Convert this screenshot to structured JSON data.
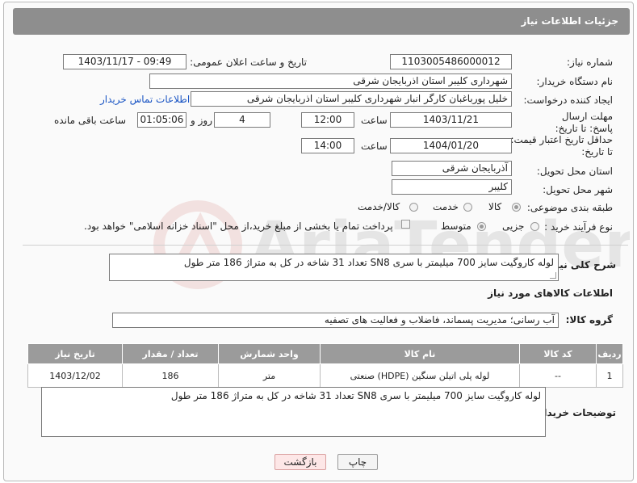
{
  "panel": {
    "title": "جزئیات اطلاعات نیاز"
  },
  "fields": {
    "need_number_label": "شماره نیاز:",
    "need_number": "1103005486000012",
    "announce_label": "تاریخ و ساعت اعلان عمومی:",
    "announce_value": "1403/11/17 - 09:49",
    "buyer_label": "نام دستگاه خریدار:",
    "buyer_value": "شهرداری کلیبر استان اذربایجان شرقی",
    "creator_label": "ایجاد کننده درخواست:",
    "creator_value": "خلیل پورباغبان کارگر انبار شهرداری کلیبر استان اذربایجان شرقی",
    "contact_link": "اطلاعات تماس خریدار",
    "deadline_label": "مهلت ارسال پاسخ: تا تاریخ:",
    "deadline_date": "1403/11/21",
    "time_word": "ساعت",
    "deadline_time": "12:00",
    "days_value": "4",
    "days_word": "روز و",
    "remaining_time": "01:05:06",
    "remaining_word": "ساعت باقی مانده",
    "price_validity_label": "حداقل تاریخ اعتبار قیمت: تا تاریخ:",
    "price_validity_date": "1404/01/20",
    "price_validity_time": "14:00",
    "province_label": "استان محل تحویل:",
    "province_value": "آذربایجان شرقی",
    "city_label": "شهر محل تحویل:",
    "city_value": "کلیبر",
    "category_label": "طبقه بندی موضوعی:",
    "category_options": [
      "کالا",
      "خدمت",
      "کالا/خدمت"
    ],
    "process_label": "نوع فرآیند خرید :",
    "process_options": [
      "جزیی",
      "متوسط"
    ],
    "payment_note": "پرداخت تمام یا بخشی از مبلغ خرید،از محل \"اسناد خزانه اسلامی\" خواهد بود.",
    "description_label": "شرح کلی نیاز:",
    "description_value": "لوله کاروگیت سایز 700 میلیمتر با سری SN8 تعداد 31 شاخه در کل به متراژ 186 متر طول",
    "goods_info_title": "اطلاعات کالاهای مورد نیاز",
    "goods_group_label": "گروه کالا:",
    "goods_group_value": "آب رسانی؛ مدیریت پسماند، فاضلاب و فعالیت های تصفیه",
    "buyer_notes_label": "توضیحات خریدار:",
    "buyer_notes_value": "لوله کاروگیت سایز 700 میلیمتر با سری SN8 تعداد 31 شاخه در کل به متراژ 186 متر طول"
  },
  "table": {
    "headers": [
      "ردیف",
      "کد کالا",
      "نام کالا",
      "واحد شمارش",
      "تعداد / مقدار",
      "تاریخ نیاز"
    ],
    "rows": [
      [
        "1",
        "--",
        "لوله پلی اتیلن سنگین (HDPE) صنعتی",
        "متر",
        "186",
        "1403/12/02"
      ]
    ]
  },
  "buttons": {
    "print": "چاپ",
    "back": "بازگشت"
  },
  "watermark": {
    "text": "AriaTender.net"
  },
  "colors": {
    "header_bg": "#8e8e8e",
    "table_header_bg": "#9b9b9b",
    "link": "#1a55c4",
    "back_button_bg": "#fde7e7"
  }
}
